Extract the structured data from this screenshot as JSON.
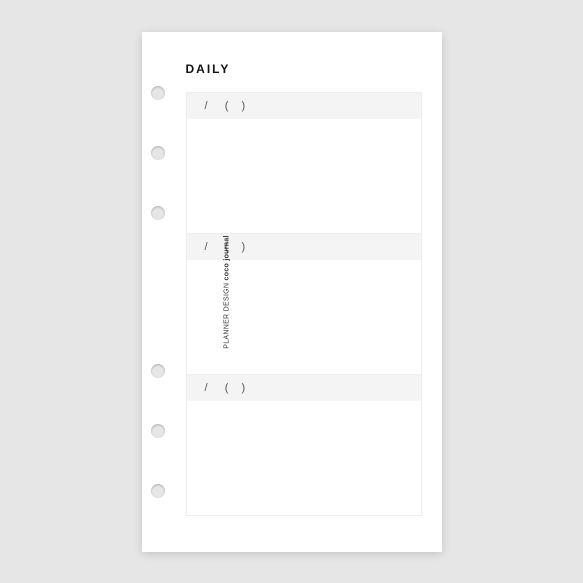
{
  "title": "DAILY",
  "spine": {
    "prefix": "PLANNER DESIGN",
    "brand": "coco journal"
  },
  "entries": [
    {
      "date_placeholder": "/",
      "day_open": "(",
      "day_close": ")"
    },
    {
      "date_placeholder": "/",
      "day_open": "(",
      "day_close": ")"
    },
    {
      "date_placeholder": "/",
      "day_open": "(",
      "day_close": ")"
    }
  ]
}
